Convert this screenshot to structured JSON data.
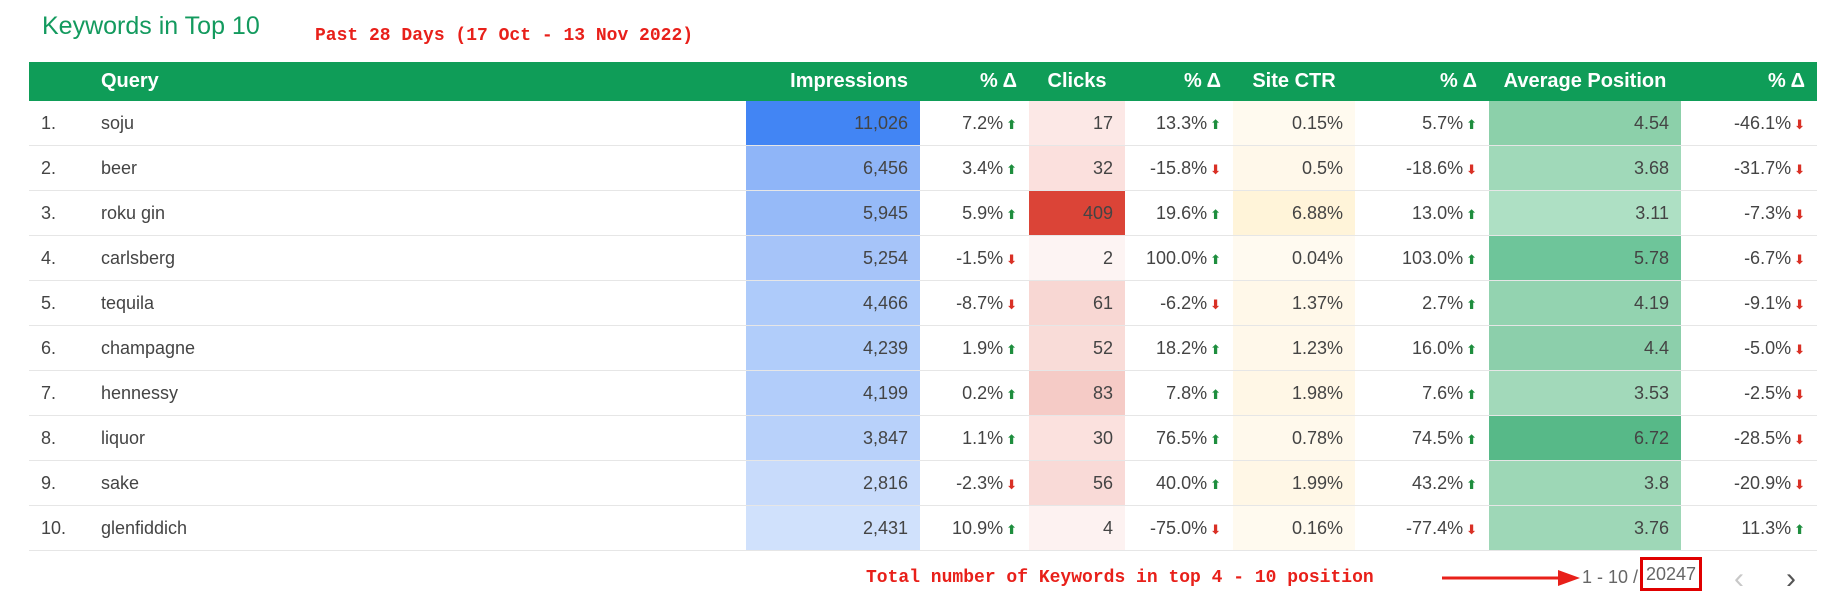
{
  "header": {
    "title": "Keywords in Top 10",
    "subtitle": "Past 28 Days (17 Oct - 13 Nov 2022)"
  },
  "columns": [
    "",
    "Query",
    "Impressions",
    "% Δ",
    "Clicks",
    "% Δ",
    "Site CTR",
    "% Δ",
    "Average Position",
    "% Δ"
  ],
  "rows": [
    {
      "rank": "1.",
      "query": "soju",
      "impressions": "11,026",
      "imp_delta": "7.2%",
      "imp_dir": "up",
      "clicks": "17",
      "clk_delta": "13.3%",
      "clk_dir": "up",
      "ctr": "0.15%",
      "ctr_delta": "5.7%",
      "ctr_dir": "up",
      "position": "4.54",
      "pos_delta": "-46.1%",
      "pos_dir": "down"
    },
    {
      "rank": "2.",
      "query": "beer",
      "impressions": "6,456",
      "imp_delta": "3.4%",
      "imp_dir": "up",
      "clicks": "32",
      "clk_delta": "-15.8%",
      "clk_dir": "down",
      "ctr": "0.5%",
      "ctr_delta": "-18.6%",
      "ctr_dir": "down",
      "position": "3.68",
      "pos_delta": "-31.7%",
      "pos_dir": "down"
    },
    {
      "rank": "3.",
      "query": "roku gin",
      "impressions": "5,945",
      "imp_delta": "5.9%",
      "imp_dir": "up",
      "clicks": "409",
      "clk_delta": "19.6%",
      "clk_dir": "up",
      "ctr": "6.88%",
      "ctr_delta": "13.0%",
      "ctr_dir": "up",
      "position": "3.11",
      "pos_delta": "-7.3%",
      "pos_dir": "down"
    },
    {
      "rank": "4.",
      "query": "carlsberg",
      "impressions": "5,254",
      "imp_delta": "-1.5%",
      "imp_dir": "down",
      "clicks": "2",
      "clk_delta": "100.0%",
      "clk_dir": "up",
      "ctr": "0.04%",
      "ctr_delta": "103.0%",
      "ctr_dir": "up",
      "position": "5.78",
      "pos_delta": "-6.7%",
      "pos_dir": "down"
    },
    {
      "rank": "5.",
      "query": "tequila",
      "impressions": "4,466",
      "imp_delta": "-8.7%",
      "imp_dir": "down",
      "clicks": "61",
      "clk_delta": "-6.2%",
      "clk_dir": "down",
      "ctr": "1.37%",
      "ctr_delta": "2.7%",
      "ctr_dir": "up",
      "position": "4.19",
      "pos_delta": "-9.1%",
      "pos_dir": "down"
    },
    {
      "rank": "6.",
      "query": "champagne",
      "impressions": "4,239",
      "imp_delta": "1.9%",
      "imp_dir": "up",
      "clicks": "52",
      "clk_delta": "18.2%",
      "clk_dir": "up",
      "ctr": "1.23%",
      "ctr_delta": "16.0%",
      "ctr_dir": "up",
      "position": "4.4",
      "pos_delta": "-5.0%",
      "pos_dir": "down"
    },
    {
      "rank": "7.",
      "query": "hennessy",
      "impressions": "4,199",
      "imp_delta": "0.2%",
      "imp_dir": "up",
      "clicks": "83",
      "clk_delta": "7.8%",
      "clk_dir": "up",
      "ctr": "1.98%",
      "ctr_delta": "7.6%",
      "ctr_dir": "up",
      "position": "3.53",
      "pos_delta": "-2.5%",
      "pos_dir": "down"
    },
    {
      "rank": "8.",
      "query": "liquor",
      "impressions": "3,847",
      "imp_delta": "1.1%",
      "imp_dir": "up",
      "clicks": "30",
      "clk_delta": "76.5%",
      "clk_dir": "up",
      "ctr": "0.78%",
      "ctr_delta": "74.5%",
      "ctr_dir": "up",
      "position": "6.72",
      "pos_delta": "-28.5%",
      "pos_dir": "down"
    },
    {
      "rank": "9.",
      "query": "sake",
      "impressions": "2,816",
      "imp_delta": "-2.3%",
      "imp_dir": "down",
      "clicks": "56",
      "clk_delta": "40.0%",
      "clk_dir": "up",
      "ctr": "1.99%",
      "ctr_delta": "43.2%",
      "ctr_dir": "up",
      "position": "3.8",
      "pos_delta": "-20.9%",
      "pos_dir": "down"
    },
    {
      "rank": "10.",
      "query": "glenfiddich",
      "impressions": "2,431",
      "imp_delta": "10.9%",
      "imp_dir": "up",
      "clicks": "4",
      "clk_delta": "-75.0%",
      "clk_dir": "down",
      "ctr": "0.16%",
      "ctr_delta": "-77.4%",
      "ctr_dir": "down",
      "position": "3.76",
      "pos_delta": "11.3%",
      "pos_dir": "up"
    }
  ],
  "heat_colors": {
    "impressions": [
      "#4285f4",
      "#8fb5f8",
      "#96baf8",
      "#a6c4f9",
      "#aecbfa",
      "#b1cdfa",
      "#b2cdfa",
      "#b8d1fa",
      "#c8dbfb",
      "#d0e1fc"
    ],
    "clicks": [
      "#fce8e6",
      "#fbe0dd",
      "#db4437",
      "#fdf4f3",
      "#f8d7d3",
      "#f9dcd8",
      "#f5cbc6",
      "#fbe1de",
      "#f9dad7",
      "#fdf2f1"
    ],
    "ctr": [
      "#fffaef",
      "#fff8ea",
      "#fff4d9",
      "#fffaf0",
      "#fff8e9",
      "#fff8ea",
      "#fff7e6",
      "#fff9ec",
      "#fff7e6",
      "#fffaef"
    ],
    "position": [
      "#8cd0aa",
      "#a0d9b9",
      "#aee0c4",
      "#6ec59a",
      "#93d3b0",
      "#8ccfab",
      "#a2d9ba",
      "#57b988",
      "#9dd7b6",
      "#9ed7b7"
    ]
  },
  "arrows": {
    "up": "⬆",
    "down": "⬇"
  },
  "pager": {
    "range": "1 - 10 /",
    "total": "20247",
    "prev_icon": "‹",
    "next_icon": "›"
  },
  "annotation": {
    "note": "Total number of Keywords in top 4 - 10 position",
    "color": "#e8201a"
  }
}
